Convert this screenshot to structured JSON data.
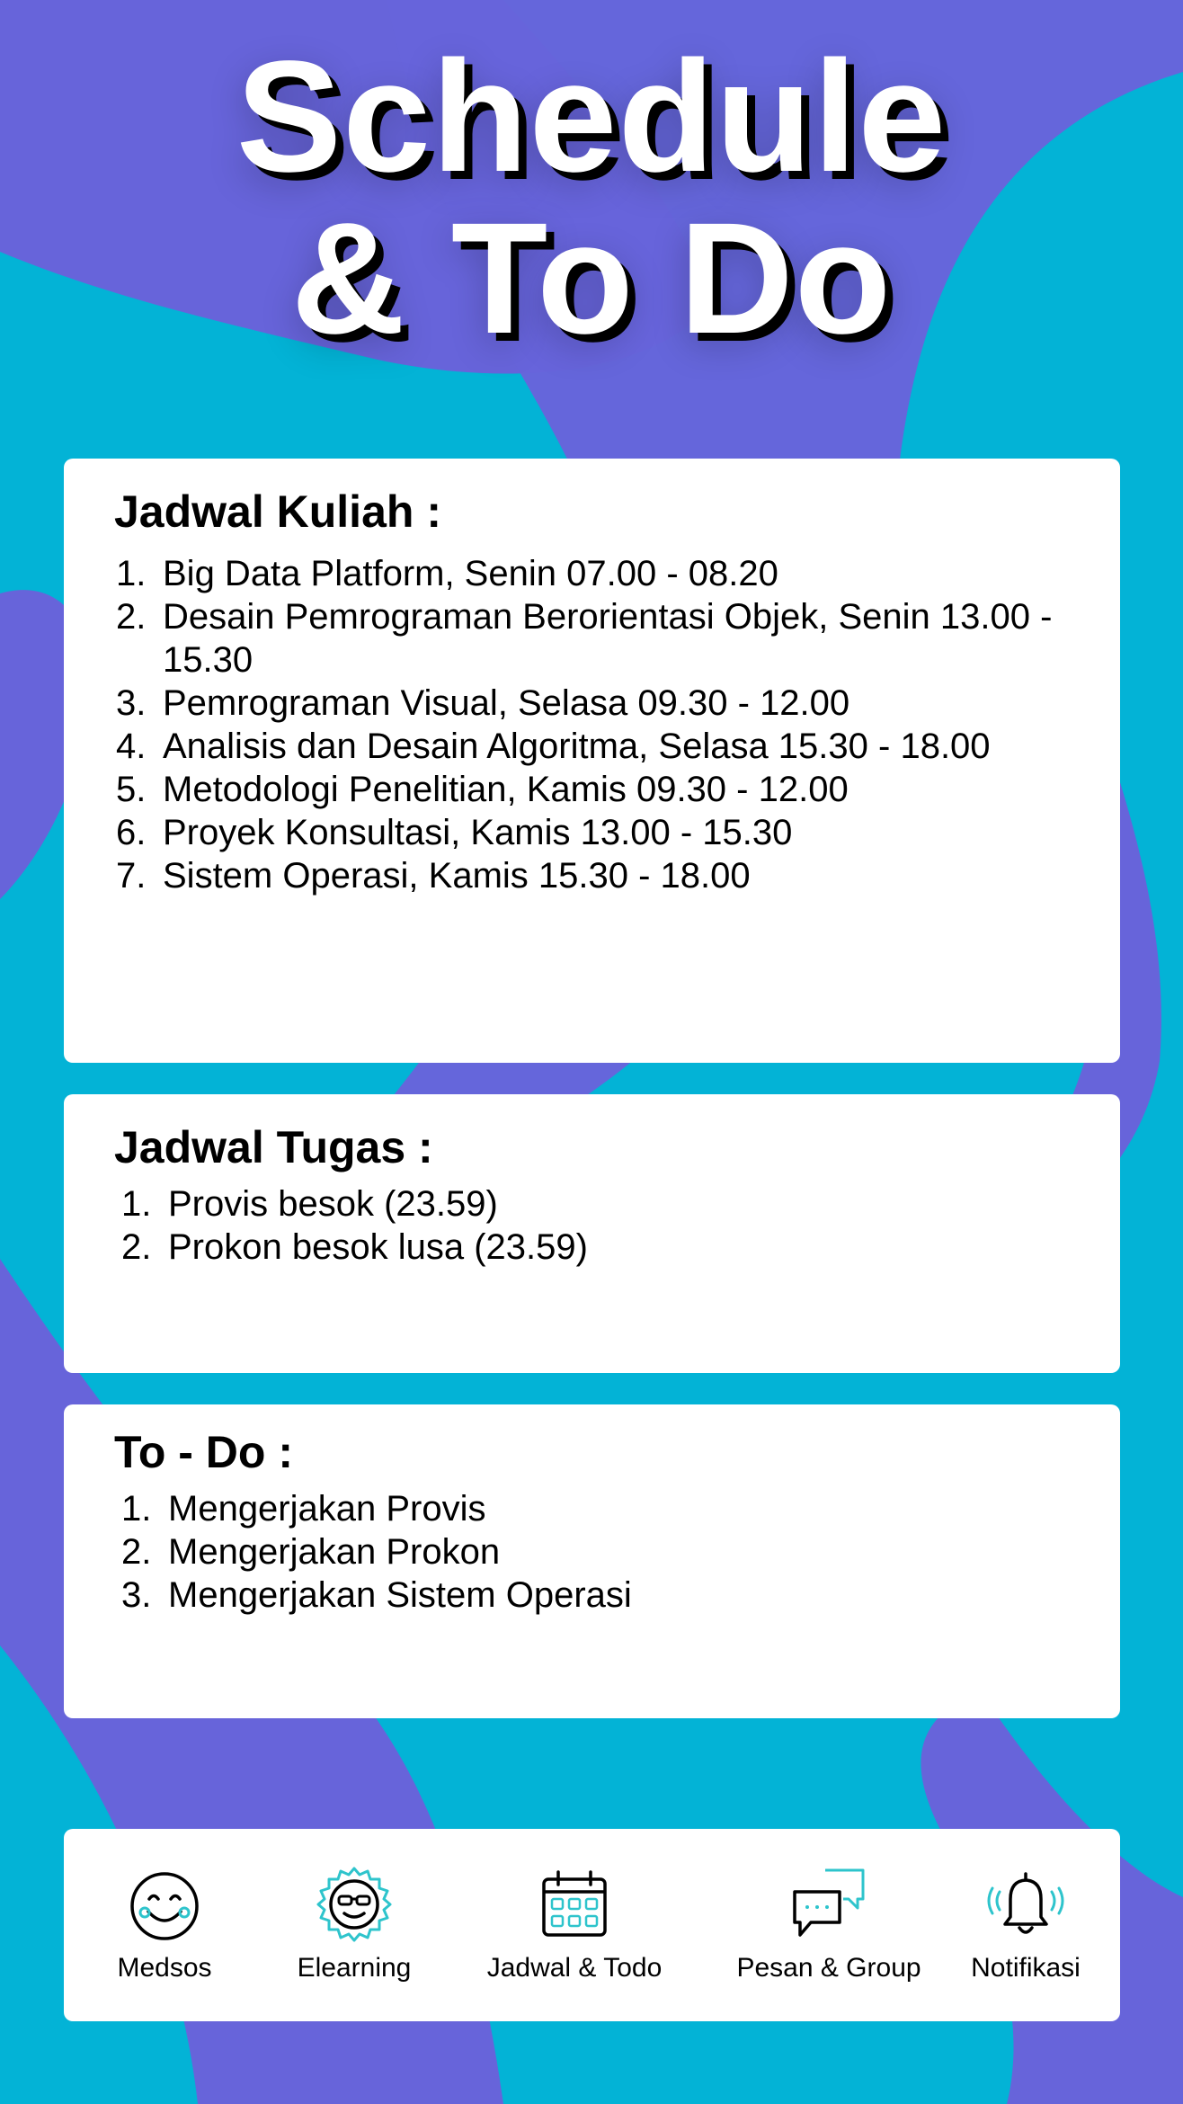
{
  "header": {
    "title_line1": "Schedule",
    "title_line2": "& To Do"
  },
  "kuliah": {
    "title": "Jadwal Kuliah :",
    "items": [
      {
        "num": "1.",
        "text": "Big Data Platform, Senin 07.00 - 08.20"
      },
      {
        "num": "2.",
        "text": "Desain Pemrograman Berorientasi Objek, Senin 13.00 - 15.30"
      },
      {
        "num": "3.",
        "text": "Pemrograman Visual, Selasa 09.30 - 12.00"
      },
      {
        "num": "4.",
        "text": "Analisis dan Desain Algoritma, Selasa 15.30 - 18.00"
      },
      {
        "num": "5.",
        "text": "Metodologi Penelitian, Kamis 09.30 - 12.00"
      },
      {
        "num": "6.",
        "text": "Proyek Konsultasi, Kamis 13.00 - 15.30"
      },
      {
        "num": "7.",
        "text": "Sistem Operasi, Kamis 15.30 - 18.00"
      }
    ]
  },
  "tugas": {
    "title": "Jadwal Tugas :",
    "items": [
      {
        "num": "1.",
        "text": "Provis besok (23.59)"
      },
      {
        "num": "2.",
        "text": "Prokon besok lusa (23.59)"
      }
    ]
  },
  "todo": {
    "title": "To - Do :",
    "items": [
      {
        "num": "1.",
        "text": "Mengerjakan Provis"
      },
      {
        "num": "2.",
        "text": "Mengerjakan Prokon"
      },
      {
        "num": "3.",
        "text": "Mengerjakan Sistem Operasi"
      }
    ]
  },
  "nav": {
    "items": [
      {
        "label": "Medsos",
        "icon": "smiley-icon"
      },
      {
        "label": "Elearning",
        "icon": "sunglasses-badge-icon"
      },
      {
        "label": "Jadwal & Todo",
        "icon": "calendar-icon"
      },
      {
        "label": "Pesan & Group",
        "icon": "chat-bubbles-icon"
      },
      {
        "label": "Notifikasi",
        "icon": "bell-icon"
      }
    ]
  },
  "colors": {
    "background": "#03b3d6",
    "stripe": "#6764da",
    "accent": "#2ec4cc",
    "card": "#ffffff",
    "text": "#000000"
  }
}
